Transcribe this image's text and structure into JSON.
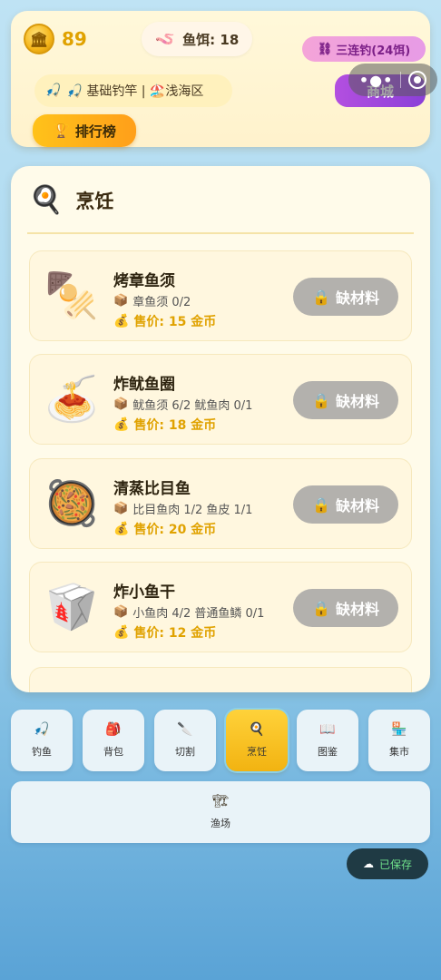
{
  "header": {
    "coins": "89",
    "bait_label": "鱼饵: 18",
    "triple_cast": "三连钓(24饵)",
    "shop": "商城",
    "gear": "🎣 基础钓竿 | 🏖️浅海区",
    "rank": "排行榜"
  },
  "cooking": {
    "title": "烹饪",
    "recipes": [
      {
        "name": "烤章鱼须",
        "materials": "章鱼须 0/2",
        "price": "售价: 15 金币",
        "button": "缺材料",
        "icon": "roasted-skewer-icon"
      },
      {
        "name": "炸鱿鱼圈",
        "materials": "鱿鱼须 6/2 鱿鱼肉 0/1",
        "price": "售价: 18 金币",
        "button": "缺材料",
        "icon": "spaghetti-icon"
      },
      {
        "name": "清蒸比目鱼",
        "materials": "比目鱼肉 1/2 鱼皮 1/1",
        "price": "售价: 20 金币",
        "button": "缺材料",
        "icon": "paella-pan-icon"
      },
      {
        "name": "炸小鱼干",
        "materials": "小鱼肉 4/2 普通鱼鳞 0/1",
        "price": "售价: 12 金币",
        "button": "缺材料",
        "icon": "takeout-box-icon"
      }
    ]
  },
  "nav": {
    "items": [
      {
        "label": "钓鱼",
        "icon": "fishing-rod-icon"
      },
      {
        "label": "背包",
        "icon": "backpack-icon"
      },
      {
        "label": "切割",
        "icon": "knife-icon"
      },
      {
        "label": "烹饪",
        "icon": "frying-pan-icon"
      },
      {
        "label": "图鉴",
        "icon": "book-icon"
      },
      {
        "label": "集市",
        "icon": "shop-icon"
      }
    ],
    "wide": {
      "label": "渔场",
      "icon": "construction-icon"
    }
  },
  "status": {
    "saved": "已保存"
  },
  "colors": {
    "accent_gold": "#e0a200",
    "active_tab": "#f2b311",
    "shop_purple": "#9b45dc"
  }
}
